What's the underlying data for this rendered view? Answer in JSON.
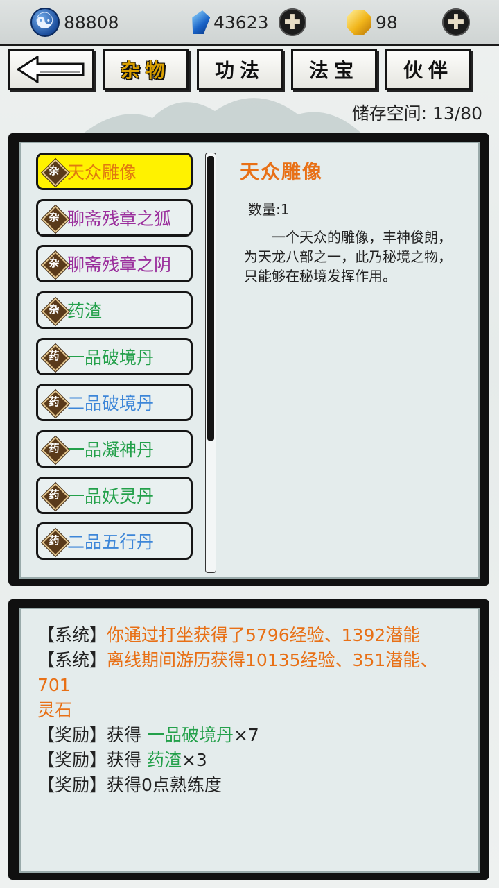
{
  "currencies": {
    "spirit": "88808",
    "jade": "43623",
    "gold": "98"
  },
  "tabs": [
    {
      "label": "杂物",
      "active": true
    },
    {
      "label": "功法",
      "active": false
    },
    {
      "label": "法宝",
      "active": false
    },
    {
      "label": "伙伴",
      "active": false
    }
  ],
  "storage": "储存空间: 13/80",
  "items": [
    {
      "badge": "杂",
      "name": "天众雕像",
      "color": "yellow",
      "selected": true
    },
    {
      "badge": "杂",
      "name": "聊斋残章之狐",
      "color": "purple"
    },
    {
      "badge": "杂",
      "name": "聊斋残章之阴",
      "color": "purple"
    },
    {
      "badge": "杂",
      "name": "药渣",
      "color": "green"
    },
    {
      "badge": "药",
      "name": "一品破境丹",
      "color": "green"
    },
    {
      "badge": "药",
      "name": "二品破境丹",
      "color": "blue"
    },
    {
      "badge": "药",
      "name": "一品凝神丹",
      "color": "green"
    },
    {
      "badge": "药",
      "name": "一品妖灵丹",
      "color": "green"
    },
    {
      "badge": "药",
      "name": "二品五行丹",
      "color": "blue"
    }
  ],
  "detail": {
    "title": "天众雕像",
    "quantity": "数量:1",
    "description": "一个天众的雕像，丰神俊朗，为天龙八部之一，此乃秘境之物，只能够在秘境发挥作用。"
  },
  "log": {
    "line1_tag": "【系统】",
    "line1_text": "你通过打坐获得了5796经验、1392潜能",
    "line2_tag": "【系统】",
    "line2_text": "离线期间游历获得10135经验、351潜能、701",
    "line2b_text": "灵石",
    "line3_tag": "【奖励】",
    "line3_pre": "获得 ",
    "line3_item": "一品破境丹",
    "line3_count": "×7",
    "line4_tag": "【奖励】",
    "line4_pre": "获得 ",
    "line4_item": "药渣",
    "line4_count": "×3",
    "line5_tag": "【奖励】",
    "line5_text": "获得0点熟练度"
  },
  "colors": {
    "selected_bg": "#fff200",
    "orange": "#e87016",
    "green": "#23a04a",
    "purple": "#9a2e9c",
    "blue": "#3d86d8"
  }
}
